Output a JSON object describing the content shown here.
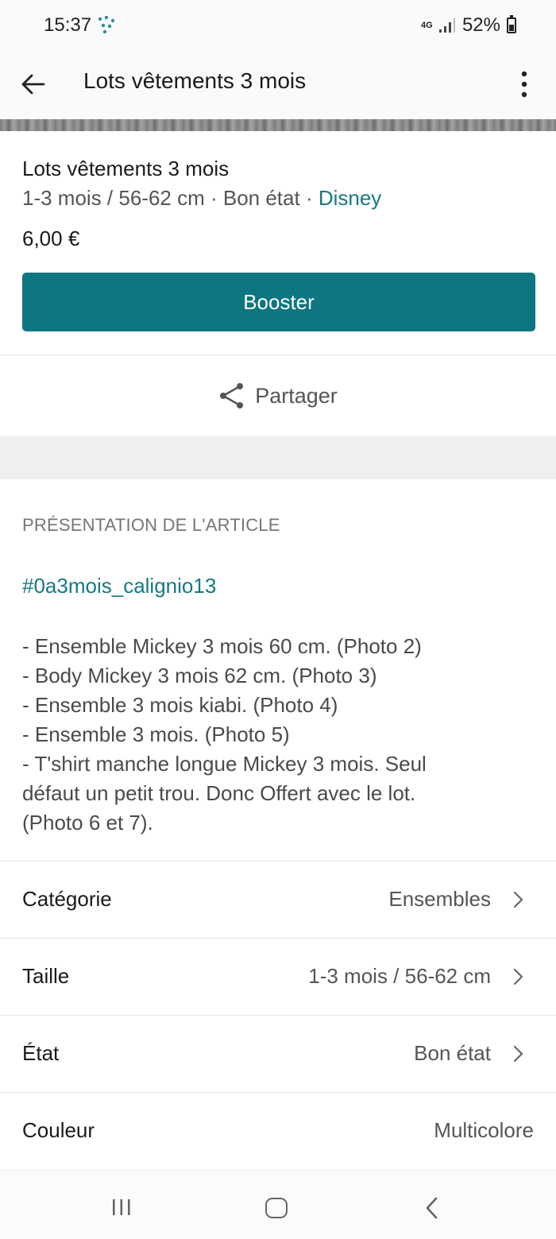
{
  "status_bar": {
    "time": "15:37",
    "network": "4G",
    "battery": "52%"
  },
  "app_bar": {
    "title": "Lots vêtements 3 mois",
    "back_icon": "arrow-left-icon",
    "more_icon": "more-vertical-icon"
  },
  "item": {
    "title": "Lots vêtements 3 mois",
    "size": "1-3 mois / 56-62 cm",
    "sep1": " · ",
    "condition": "Bon état",
    "sep2": " · ",
    "brand": "Disney",
    "price": "6,00 €"
  },
  "actions": {
    "boost_label": "Booster",
    "share_label": "Partager"
  },
  "description": {
    "heading": "PRÉSENTATION DE L'ARTICLE",
    "hashtag": "#0a3mois_calignio13",
    "lines": [
      "- Ensemble Mickey 3 mois 60 cm. (Photo 2)",
      "- Body Mickey 3 mois 62 cm. (Photo 3)",
      "- Ensemble 3 mois kiabi. (Photo 4)",
      "- Ensemble 3 mois. (Photo 5)",
      "- T'shirt manche longue Mickey 3 mois. Seul",
      "défaut un petit trou. Donc Offert avec le lot.",
      "(Photo 6 et 7)."
    ]
  },
  "attributes": [
    {
      "label": "Catégorie",
      "value": "Ensembles"
    },
    {
      "label": "Taille",
      "value": "1-3 mois / 56-62 cm"
    },
    {
      "label": "État",
      "value": "Bon état"
    },
    {
      "label": "Couleur",
      "value": "Multicolore"
    }
  ],
  "colors": {
    "accent": "#0d7680",
    "link": "#157a83"
  }
}
